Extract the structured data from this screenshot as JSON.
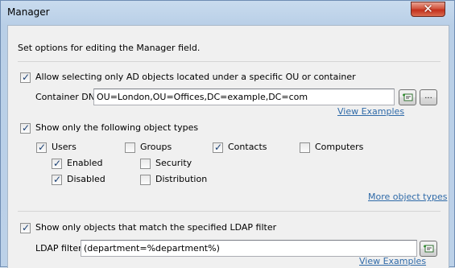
{
  "window": {
    "title": "Manager"
  },
  "description": "Set options for editing the Manager field.",
  "ou_section": {
    "checkbox_label": "Allow selecting only AD objects located under a specific OU or container",
    "checked": true,
    "container_label": "Container DN:",
    "container_value": "OU=London,OU=Offices,DC=example,DC=com",
    "browse_label": "...",
    "examples_link": "View Examples"
  },
  "types_section": {
    "checkbox_label": "Show only the following object types",
    "checked": true,
    "users": {
      "label": "Users",
      "checked": true
    },
    "enabled": {
      "label": "Enabled",
      "checked": true
    },
    "disabled": {
      "label": "Disabled",
      "checked": true
    },
    "groups": {
      "label": "Groups",
      "checked": false
    },
    "security": {
      "label": "Security",
      "checked": false
    },
    "distribution": {
      "label": "Distribution",
      "checked": false
    },
    "contacts": {
      "label": "Contacts",
      "checked": true
    },
    "computers": {
      "label": "Computers",
      "checked": false
    },
    "more_link": "More object types"
  },
  "ldap_section": {
    "checkbox_label": "Show only objects that match the specified LDAP filter",
    "checked": true,
    "filter_label": "LDAP filter:",
    "filter_value": "(department=%department%)",
    "examples_link": "View Examples"
  },
  "icons": {
    "close": "close-icon",
    "insert": "insert-field-icon"
  }
}
